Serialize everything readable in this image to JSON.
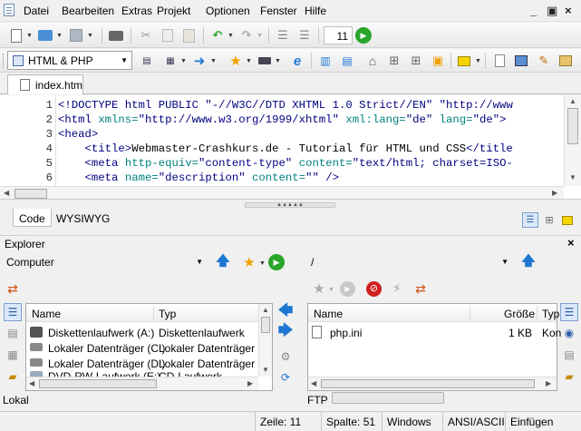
{
  "menu": {
    "items": [
      "Datei",
      "Bearbeiten",
      "Extras",
      "Projekt",
      "Optionen",
      "Fenster",
      "Hilfe"
    ],
    "window_controls": [
      "_",
      "▣",
      "×"
    ]
  },
  "toolbar1": {
    "counter_value": "11"
  },
  "toolbar2": {
    "language_select": "HTML & PHP"
  },
  "tabs": {
    "active_file": "index.htm"
  },
  "editor": {
    "lines": [
      {
        "num": "1",
        "parts": [
          [
            "tg",
            "<!DOCTYPE html PUBLIC "
          ],
          [
            "st",
            "\"-//W3C//DTD XHTML 1.0 Strict//EN\""
          ],
          [
            "tg",
            " \"http://www"
          ]
        ]
      },
      {
        "num": "2",
        "parts": [
          [
            "tg",
            "<html "
          ],
          [
            "at",
            "xmlns="
          ],
          [
            "st",
            "\"http://www.w3.org/1999/xhtml\""
          ],
          [
            "at",
            " xml:lang="
          ],
          [
            "st",
            "\"de\""
          ],
          [
            "at",
            " lang="
          ],
          [
            "st",
            "\"de\""
          ],
          [
            "tg",
            ">"
          ]
        ]
      },
      {
        "num": "3",
        "parts": [
          [
            "tg",
            "<head>"
          ]
        ]
      },
      {
        "num": "4",
        "parts": [
          [
            "tx",
            "    "
          ],
          [
            "tg",
            "<title>"
          ],
          [
            "tx",
            "Webmaster-Crashkurs.de - Tutorial für HTML und CSS"
          ],
          [
            "tg",
            "</title"
          ]
        ]
      },
      {
        "num": "5",
        "parts": [
          [
            "tx",
            "    "
          ],
          [
            "tg",
            "<meta "
          ],
          [
            "at",
            "http-equiv="
          ],
          [
            "st",
            "\"content-type\""
          ],
          [
            "at",
            " content="
          ],
          [
            "st",
            "\"text/html; charset=ISO-"
          ]
        ]
      },
      {
        "num": "6",
        "parts": [
          [
            "tx",
            "    "
          ],
          [
            "tg",
            "<meta "
          ],
          [
            "at",
            "name="
          ],
          [
            "st",
            "\"description\""
          ],
          [
            "at",
            " content="
          ],
          [
            "st",
            "\"\""
          ],
          [
            "tg",
            " />"
          ]
        ]
      }
    ]
  },
  "view_tabs": [
    "Code",
    "WYSIWYG"
  ],
  "explorer": {
    "title": "Explorer",
    "left": {
      "location": "Computer",
      "columns": [
        "Name",
        "Typ"
      ],
      "rows": [
        {
          "name": "Diskettenlaufwerk (A:)",
          "type": "Diskettenlaufwerk"
        },
        {
          "name": "Lokaler Datenträger (C:)",
          "type": "Lokaler Datenträger"
        },
        {
          "name": "Lokaler Datenträger (D:)",
          "type": "Lokaler Datenträger"
        },
        {
          "name": "DVD-RW-Laufwerk (E:)",
          "type": "CD-Laufwerk"
        }
      ],
      "footer_label": "Lokal"
    },
    "right": {
      "location": "/",
      "columns": [
        "Name",
        "Größe",
        "Typ"
      ],
      "rows": [
        {
          "name": "php.ini",
          "size": "1 KB",
          "type": "Kon"
        }
      ],
      "footer_label": "FTP"
    }
  },
  "status": {
    "line": "Zeile: 11",
    "column": "Spalte: 51",
    "os": "Windows",
    "encoding": "ANSI/ASCII",
    "mode": "Einfügen"
  },
  "colors": {
    "tag": "#000080",
    "attribute": "#008080",
    "accent_green": "#2aa52a",
    "accent_blue": "#1e78d2"
  }
}
